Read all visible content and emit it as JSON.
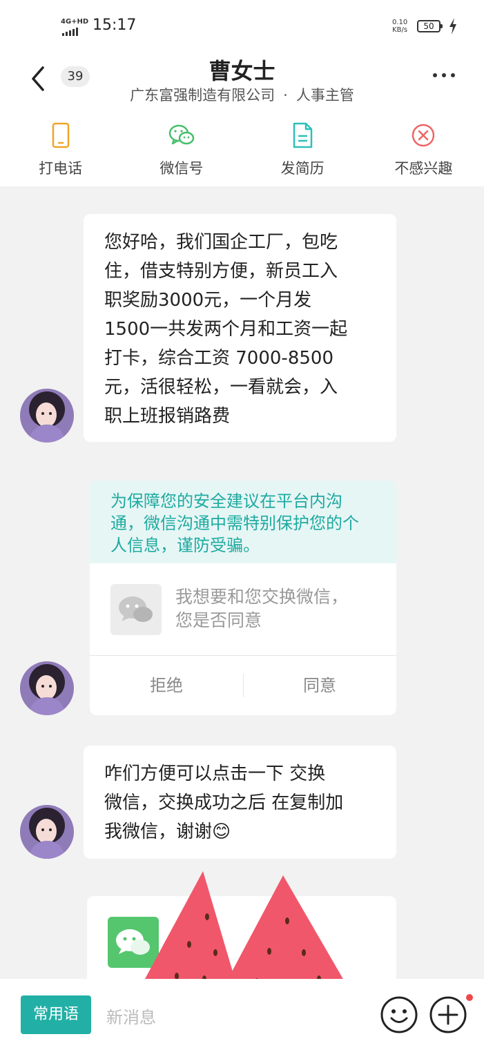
{
  "status": {
    "network": "4G+HD",
    "time": "15:17",
    "speed_value": "0.10",
    "speed_unit": "KB/s",
    "battery": "50"
  },
  "header": {
    "unread_count": "39",
    "name": "曹女士",
    "company": "广东富强制造有限公司",
    "separator": "·",
    "position": "人事主管"
  },
  "actions": [
    {
      "label": "打电话",
      "icon": "phone-icon"
    },
    {
      "label": "微信号",
      "icon": "wechat-icon"
    },
    {
      "label": "发简历",
      "icon": "resume-icon"
    },
    {
      "label": "不感兴趣",
      "icon": "not-interested-icon"
    }
  ],
  "messages": [
    {
      "text": "您好哈，我们国企工厂，包吃\n住，借支特别方便，新员工入\n职奖励3000元，一个月发\n1500一共发两个月和工资一起\n打卡，综合工资 7000-8500\n元，活很轻松，一看就会，入\n职上班报销路费"
    },
    {
      "notice": "为保障您的安全建议在平台内沟\n通，微信沟通中需特别保护您的个\n人信息，谨防受骗。",
      "request": "我想要和您交换微信，\n您是否同意",
      "reject_label": "拒绝",
      "accept_label": "同意"
    },
    {
      "text": "咋们方便可以点击一下   交换\n微信，交换成功之后 在复制加\n我微信，谢谢😊"
    }
  ],
  "input": {
    "common_phrases_label": "常用语",
    "placeholder": "新消息"
  },
  "colors": {
    "accent": "#22b0a6",
    "notice_bg": "#e6f6f5",
    "notice_text": "#1eaaa0",
    "wechat_green": "#55c66e",
    "red_dot": "#f04848"
  }
}
